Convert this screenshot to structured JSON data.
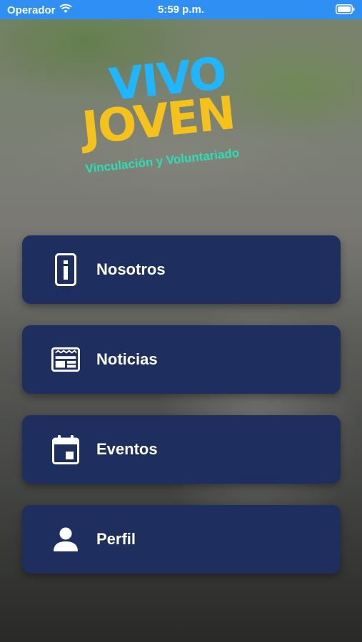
{
  "status_bar": {
    "carrier": "Operador",
    "time": "5:59 p.m."
  },
  "logo": {
    "line1": "VIVO",
    "line2": "JOVEN",
    "tagline": "Vinculación y Voluntariado",
    "colors": {
      "vivo": "#1fb6ff",
      "joven": "#f5c21b",
      "accent": "#28e0b8"
    }
  },
  "menu": [
    {
      "label": "Nosotros",
      "icon": "info-phone-icon"
    },
    {
      "label": "Noticias",
      "icon": "newspaper-icon"
    },
    {
      "label": "Eventos",
      "icon": "calendar-icon"
    },
    {
      "label": "Perfil",
      "icon": "person-icon"
    }
  ],
  "colors": {
    "status_bar": "#2f8ff3",
    "button": "#1e2e5f"
  }
}
